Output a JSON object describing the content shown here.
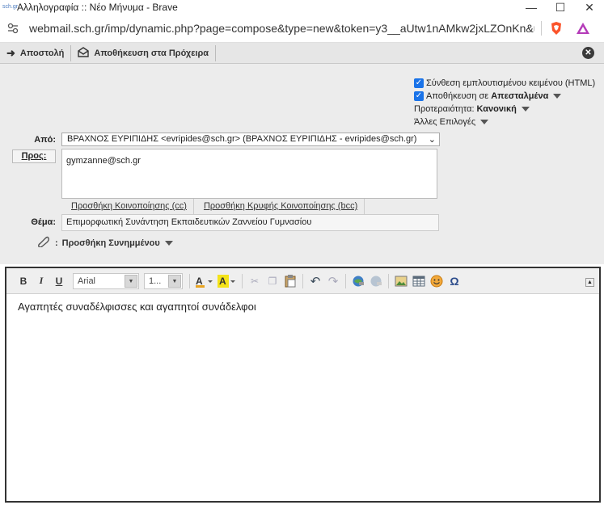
{
  "window": {
    "title": "Αλληλογραφία :: Νέο Μήνυμα - Brave",
    "app_icon_text": "sch.gr",
    "minimize": "—",
    "maximize": "☐",
    "close": "✕"
  },
  "address": {
    "url": "webmail.sch.gr/imp/dynamic.php?page=compose&type=new&token=y3__aUtw1nAMkw2jxLZOnKn&uniq=17..."
  },
  "toolbar": {
    "send_label": "Αποστολή",
    "save_draft_label": "Αποθήκευση στα Πρόχειρα"
  },
  "options": {
    "html_editor_label": "Σύνθεση εμπλουτισμένου κειμένου (HTML)",
    "save_sent_prefix": "Αποθήκευση σε ",
    "save_sent_folder": "Απεσταλμένα",
    "priority_prefix": "Προτεραιότητα: ",
    "priority_value": "Κανονική",
    "other_options": "Άλλες Επιλογές"
  },
  "compose": {
    "from_label": "Από:",
    "from_value": "ΒΡΑΧΝΟΣ ΕΥΡΙΠΙΔΗΣ <evripides@sch.gr> (ΒΡΑΧΝΟΣ ΕΥΡΙΠΙΔΗΣ - evripides@sch.gr)",
    "to_button": "Προς:",
    "to_value": "gymzanne@sch.gr",
    "add_cc": "Προσθήκη Κοινοποίησης (cc)",
    "add_bcc": "Προσθήκη Κρυφής Κοινοποίησης (bcc)",
    "subject_label": "Θέμα:",
    "subject_value": "Επιμορφωτική Συνάντηση Εκπαιδευτικών Ζαννείου Γυμνασίου",
    "attach_label": "Προσθήκη Συνημμένου",
    "attach_separator": ":"
  },
  "editor": {
    "bold": "B",
    "italic": "I",
    "underline": "U",
    "font_family": "Arial",
    "font_size": "1...",
    "body": "Αγαπητές συναδέλφισσες και αγαπητοί συνάδελφοι"
  },
  "colors": {
    "checkbox": "#1a73e8",
    "toolbar_bg": "#e6e6e6",
    "header_bg": "#ececec"
  }
}
